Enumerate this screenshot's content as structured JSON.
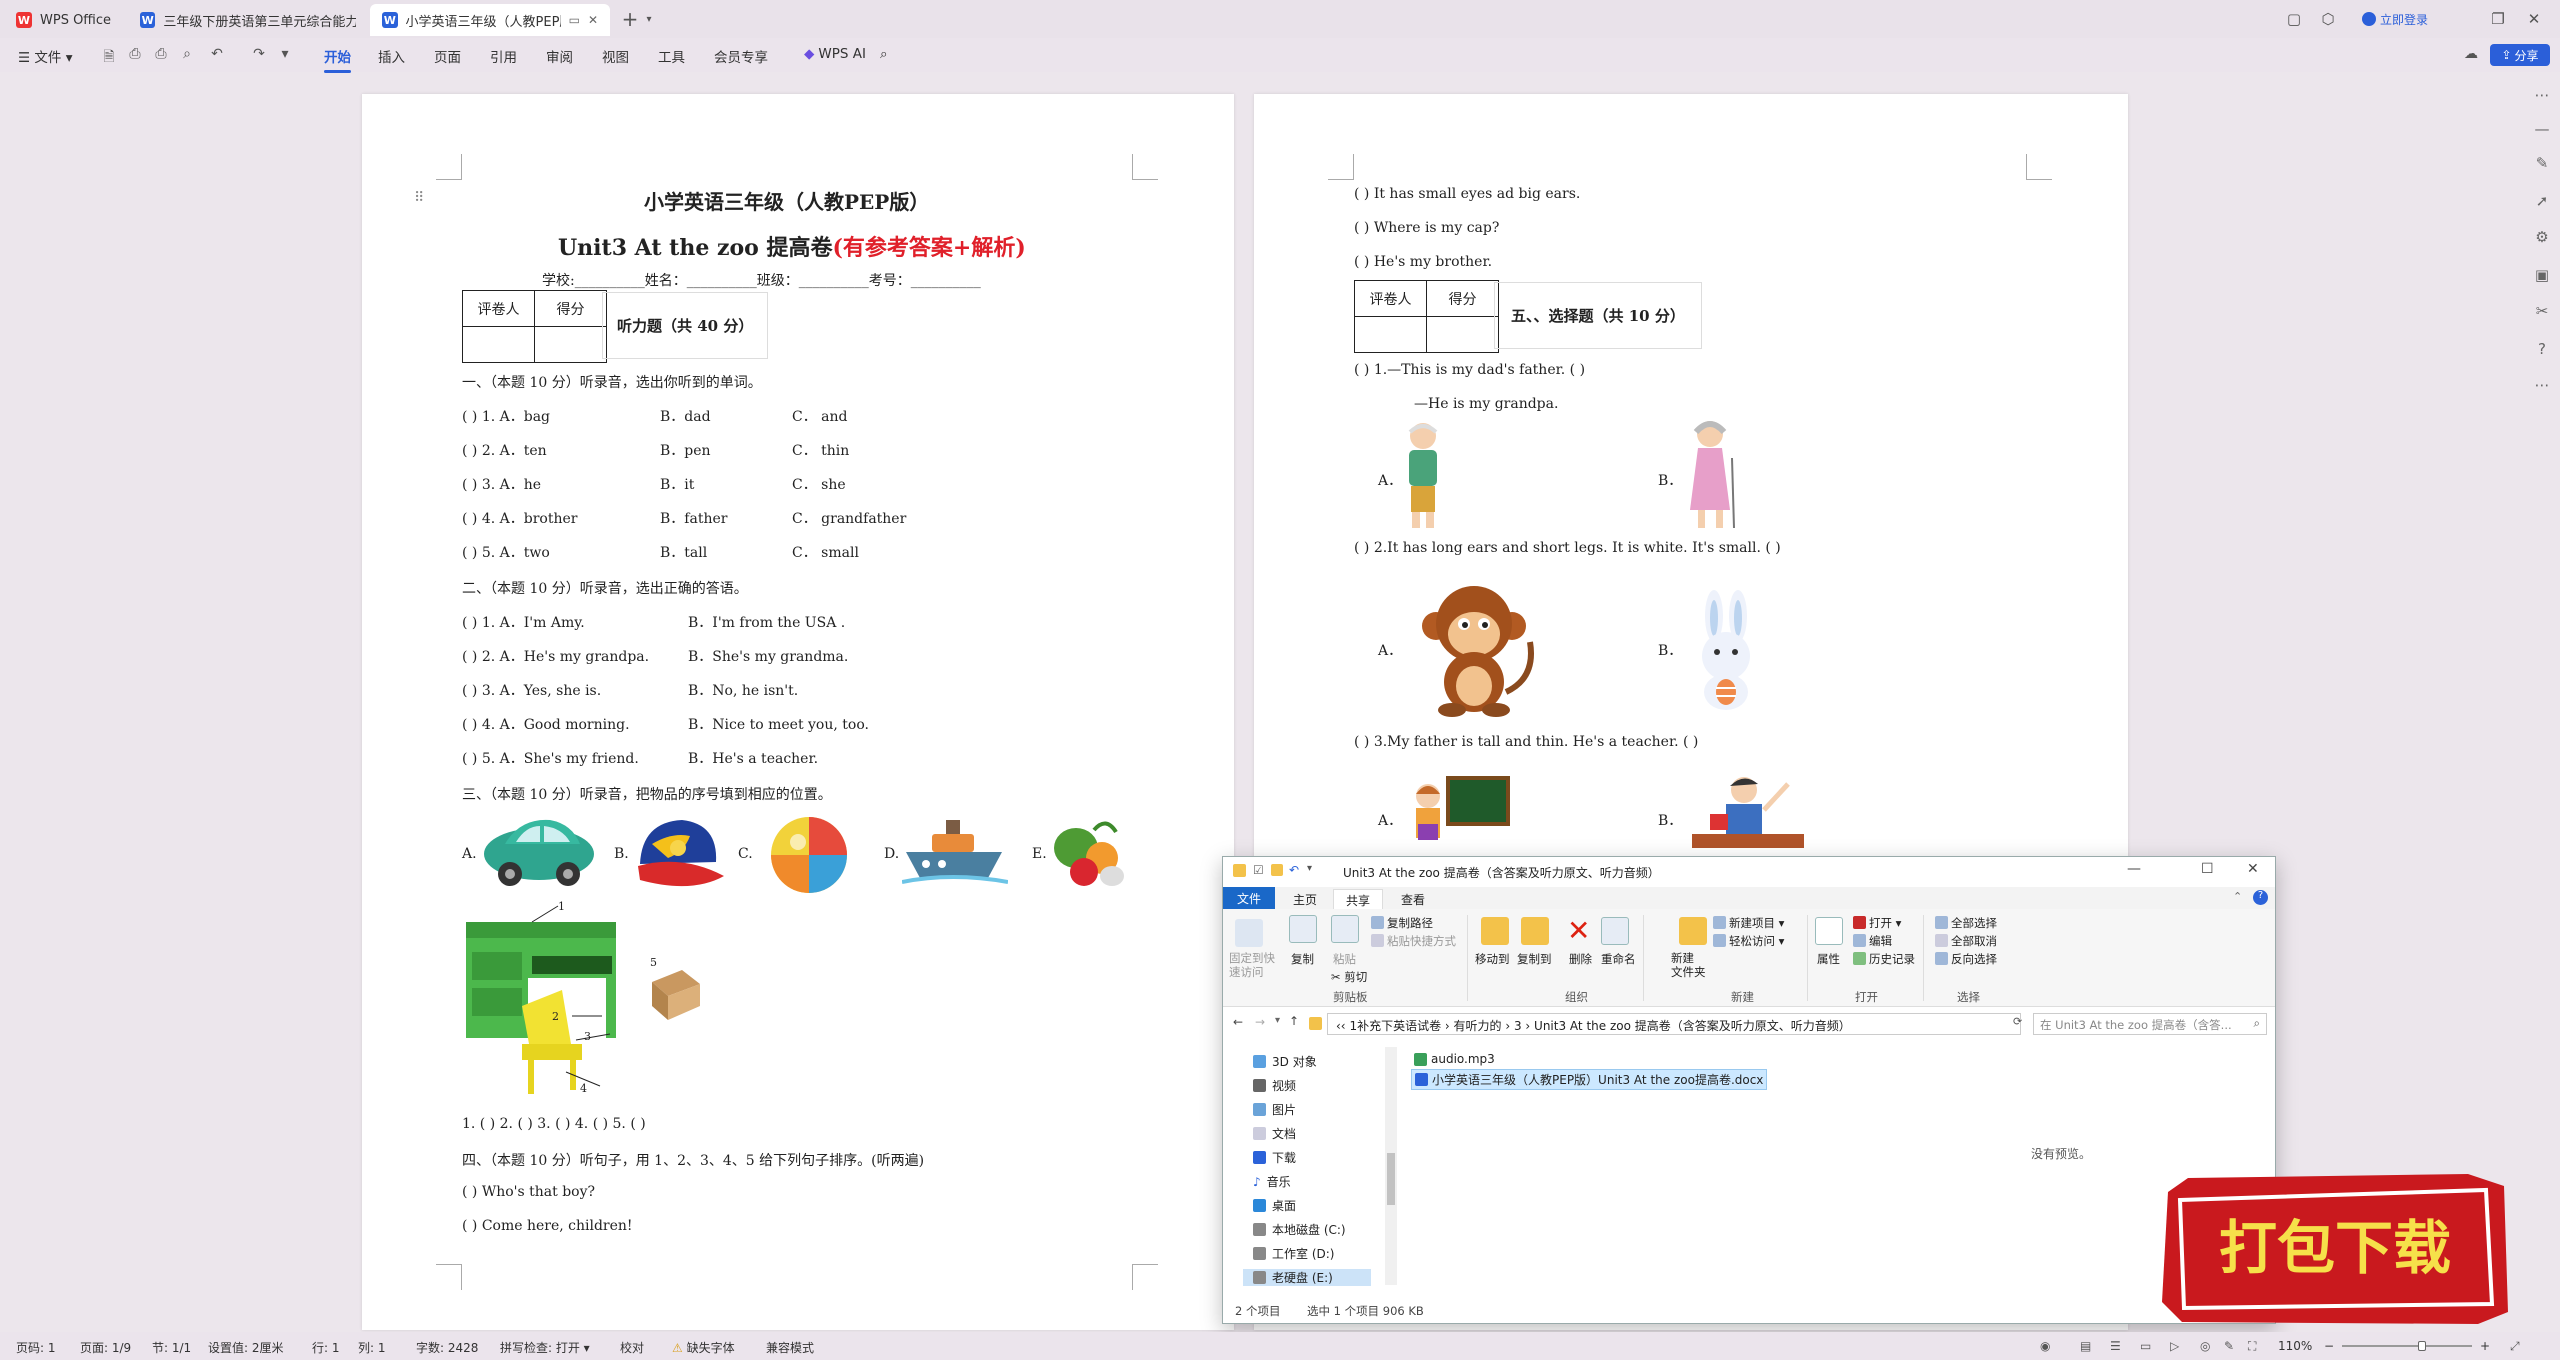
{
  "tabs": [
    {
      "label": "WPS Office",
      "icon": "wps-logo-icon"
    },
    {
      "label": "三年级下册英语第三单元综合能力提(",
      "icon": "document-icon"
    },
    {
      "label": "小学英语三年级（人教PEP版）",
      "icon": "document-icon"
    }
  ],
  "titlebar": {
    "login": "立即登录",
    "new_tab": "+"
  },
  "menu": {
    "file": "文件",
    "items": [
      "开始",
      "插入",
      "页面",
      "引用",
      "审阅",
      "视图",
      "工具",
      "会员专享"
    ],
    "ai": "WPS AI",
    "share": "分享"
  },
  "page1": {
    "title": "小学英语三年级（人教PEP版）",
    "subtitle_black": "Unit3 At the zoo 提高卷",
    "subtitle_red": "(有参考答案+解析)",
    "info": "学校:__________姓名：__________班级：__________考号：__________",
    "score_headers": [
      "评卷人",
      "得分"
    ],
    "section_label": "听力题（共 40 分）",
    "s1": "一、（本题 10 分）听录音，选出你听到的单词。",
    "q1": [
      [
        "(          ) 1. A．bag",
        "B．dad",
        "C．  and"
      ],
      [
        "(          ) 2. A．ten",
        "B．pen",
        "C．  thin"
      ],
      [
        "(          ) 3. A．he",
        "B．it",
        "C．  she"
      ],
      [
        "(          ) 4. A．brother",
        "B．father",
        "C．  grandfather"
      ],
      [
        "(          ) 5. A．two",
        "B．tall",
        "C．  small"
      ]
    ],
    "s2": "二、（本题 10 分）听录音，选出正确的答语。",
    "q2": [
      [
        "(          ) 1. A．I'm Amy.",
        "B．I'm from the USA ."
      ],
      [
        "(          ) 2. A．He's my grandpa.",
        "B．She's my grandma."
      ],
      [
        "(          ) 3. A．Yes, she is.",
        "B．No, he isn't."
      ],
      [
        "(          ) 4. A．Good morning.",
        "B．Nice to meet you, too."
      ],
      [
        "(          ) 5. A．She's my friend.",
        "B．He's a teacher."
      ]
    ],
    "s3": "三、（本题 10 分）听录音，把物品的序号填到相应的位置。",
    "pic_labels": [
      "A.",
      "B.",
      "C.",
      "D.",
      "E."
    ],
    "numbers": [
      "1",
      "2",
      "3",
      "4",
      "5"
    ],
    "answer_line": "1. (          )  2. (          )  3. (          )  4. (          )  5. (          )",
    "s4": "四、（本题 10 分）听句子，用 1、2、3、4、5 给下列句子排序。(听两遍)",
    "q4": [
      "(          ) Who's that boy?",
      "(          ) Come here, children!"
    ]
  },
  "page2": {
    "q4_more": [
      "(          ) It has small eyes ad big ears.",
      "(          ) Where is my cap?",
      "(          ) He's my brother."
    ],
    "score_headers": [
      "评卷人",
      "得分"
    ],
    "section_label": "五、、选择题（共 10 分）",
    "q5_1": "(          ) 1.—This is my dad's father. (   )",
    "q5_1b": "—He is my grandpa.",
    "q5_2": "(          ) 2.It has long ears and short legs. It is white. It's small. (   )",
    "q5_3": "(          ) 3.My father is tall and thin. He's a teacher. (   )",
    "opt_a": "A．",
    "opt_b": "B．"
  },
  "explorer": {
    "title": "Unit3 At the zoo 提高卷（含答案及听力原文、听力音频）",
    "tabs": [
      "文件",
      "主页",
      "共享",
      "查看"
    ],
    "ribbon": {
      "pin": "固定到快\n速访问",
      "copy": "复制",
      "paste": "粘贴",
      "copy_path": "复制路径",
      "paste_shortcut": "粘贴快捷方式",
      "cut": "剪切",
      "clipboard": "剪贴板",
      "move_to": "移动到",
      "copy_to": "复制到",
      "delete": "删除",
      "rename": "重命名",
      "organize": "组织",
      "new_folder": "新建\n文件夹",
      "new_item": "新建项目",
      "easy_access": "轻松访问",
      "new": "新建",
      "properties": "属性",
      "open": "打开",
      "edit": "编辑",
      "history": "历史记录",
      "open_group": "打开",
      "select_all": "全部选择",
      "select_none": "全部取消",
      "invert": "反向选择",
      "select": "选择"
    },
    "path": [
      "1补充下英语试卷",
      "有听力的",
      "3",
      "Unit3 At the zoo 提高卷（含答案及听力原文、听力音频）"
    ],
    "search_placeholder": "在 Unit3 At the zoo 提高卷（含答...",
    "nav": [
      "3D 对象",
      "视频",
      "图片",
      "文档",
      "下载",
      "音乐",
      "桌面",
      "本地磁盘 (C:)",
      "工作室 (D:)",
      "老硬盘 (E:)"
    ],
    "files": [
      "audio.mp3",
      "小学英语三年级（人教PEP版）Unit3 At the zoo提高卷.docx"
    ],
    "no_preview": "没有预览。",
    "status": "2 个项目",
    "status_sel": "选中 1 个项目  906 KB"
  },
  "badge": {
    "text": "打包下载"
  },
  "statusbar": {
    "page": "页码: 1",
    "pages": "页面: 1/9",
    "section": "节: 1/1",
    "setting": "设置值: 2厘米",
    "row": "行: 1",
    "col": "列: 1",
    "words": "字数: 2428",
    "spell": "拼写检查: 打开 ▾",
    "proof": "校对",
    "missing_font": "缺失字体",
    "compat": "兼容模式",
    "zoom": "110%"
  }
}
